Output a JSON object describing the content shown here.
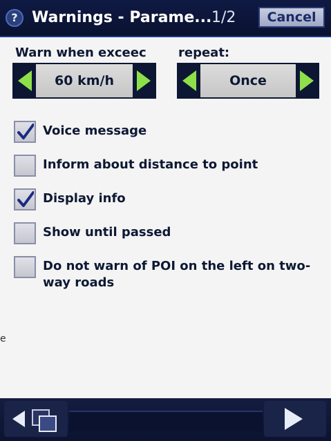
{
  "header": {
    "help_icon": "question-mark-icon",
    "help_glyph": "?",
    "title": "Warnings - Parame...",
    "page_indicator": "1/2",
    "cancel_label": "Cancel"
  },
  "speed": {
    "label": "Warn when exceec",
    "value": "60 km/h"
  },
  "repeat": {
    "label": "repeat:",
    "value": "Once"
  },
  "options": [
    {
      "label": "Voice message",
      "checked": true
    },
    {
      "label": "Inform about distance to point",
      "checked": false
    },
    {
      "label": "Display info",
      "checked": true
    },
    {
      "label": "Show until passed",
      "checked": false
    },
    {
      "label": "Do not warn of POI on the left on two-way roads",
      "checked": false
    }
  ],
  "edge_mark": "e",
  "footer": {
    "back_icon": "back-arrow-icon",
    "windows_icon": "switch-windows-icon",
    "next_icon": "next-arrow-icon"
  },
  "colors": {
    "arrow_green": "#8ee04a",
    "check_blue": "#1b2a80",
    "title_bg": "#0f1a44"
  }
}
